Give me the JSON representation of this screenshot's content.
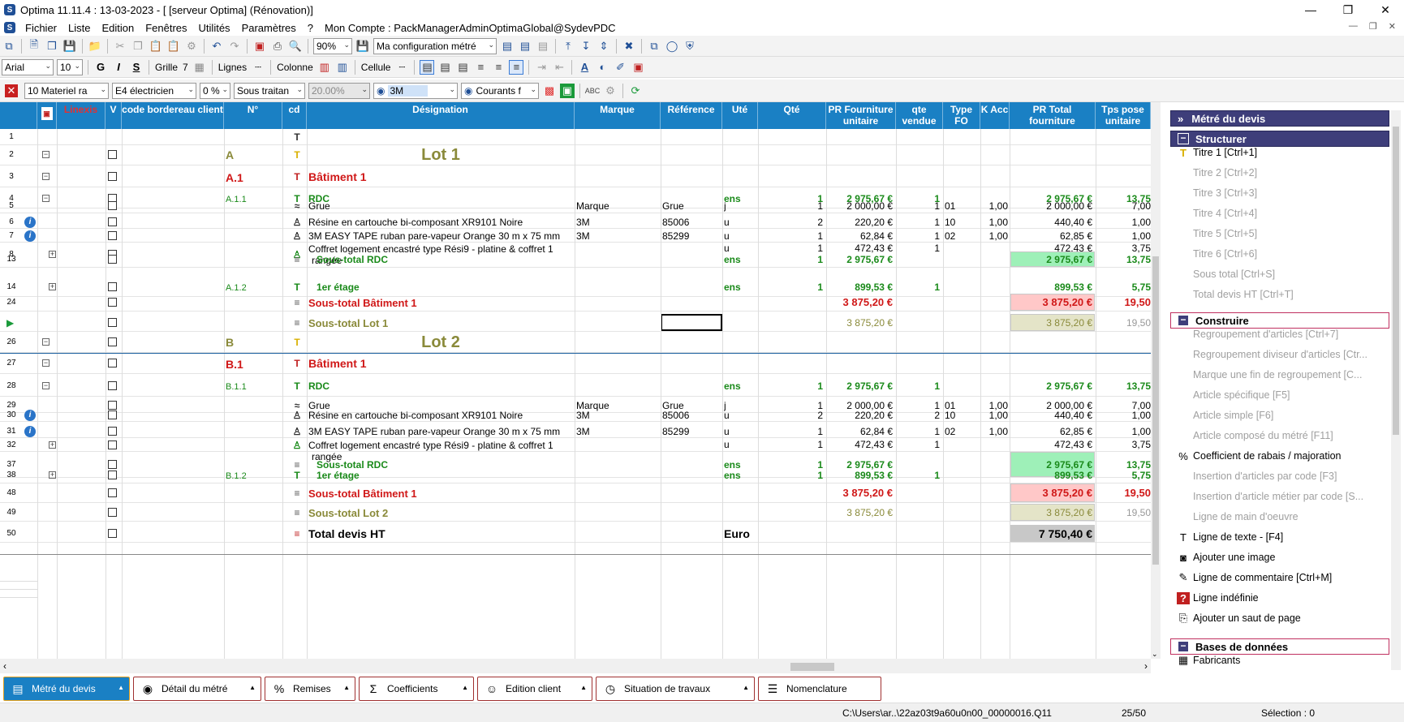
{
  "window": {
    "title": "Optima 11.11.4 : 13-03-2023 - [ [serveur Optima] (Rénovation)]",
    "app_icon": "S"
  },
  "menu": [
    "Fichier",
    "Liste",
    "Edition",
    "Fenêtres",
    "Utilités",
    "Paramètres",
    "?",
    "Mon Compte : PackManagerAdminOptimaGlobal@SydevPDC"
  ],
  "toolbar1": {
    "zoom": "90%",
    "config": "Ma configuration métré"
  },
  "toolbar2": {
    "font": "Arial",
    "size": "10",
    "bold": "G",
    "italic": "I",
    "underline": "S",
    "grille": "Grille",
    "grille_num": "7",
    "lignes": "Lignes",
    "colonne": "Colonne",
    "cellule": "Cellule"
  },
  "toolbar3": {
    "materiel": "10  Materiel ra",
    "electricien": "E4  électricien",
    "pct": "0 %",
    "sous_traitan": "Sous traitan",
    "rate": "20.00%",
    "brand": "3M",
    "courants": "Courants f"
  },
  "columns": {
    "linexis": "Linexis",
    "v": "V",
    "code": "code bordereau client",
    "n": "N°",
    "cd": "cd",
    "designation": "Désignation",
    "marque": "Marque",
    "reference": "Référence",
    "ute": "Uté",
    "qte": "Qté",
    "pr_unit": "PR Fourniture unitaire",
    "qte_vendue": "qte vendue",
    "type_fo": "Type FO",
    "k_acc": "K Acc",
    "pr_total": "PR Total fourniture",
    "tps": "Tps pose unitaire"
  },
  "rows": [
    {
      "rn": "1",
      "n": "",
      "des": "",
      "ico": "T",
      "kind": "blank"
    },
    {
      "rn": "2",
      "n": "A",
      "des": "Lot 1",
      "ico": "T1",
      "kind": "lot",
      "tog": "−"
    },
    {
      "rn": "3",
      "n": "A.1",
      "des": "Bâtiment 1",
      "ico": "T2",
      "kind": "bat",
      "tog": "−"
    },
    {
      "rn": "4",
      "n": "A.1.1",
      "des": "RDC",
      "ico": "T3",
      "kind": "rdc",
      "tog": "−",
      "ute": "ens",
      "qte": "1",
      "pru": "2 975,67 €",
      "qv": "1",
      "prt": "2 975,67 €",
      "tps": "13,75"
    },
    {
      "rn": "5",
      "n": "",
      "des": "Grue",
      "ico": "≈",
      "kind": "art",
      "marque": "Marque",
      "ref": "Grue",
      "ute": "j",
      "qte": "1",
      "pru": "2 000,00 €",
      "qv": "1",
      "fo": "01",
      "k": "1,00",
      "prt": "2 000,00 €",
      "tps": "7,00"
    },
    {
      "rn": "6",
      "n": "",
      "des": "Résine en cartouche bi-composant XR9101 Noire",
      "ico": "A",
      "kind": "art",
      "info": true,
      "marque": "3M",
      "ref": "85006",
      "ute": "u",
      "qte": "2",
      "pru": "220,20 €",
      "qv": "1",
      "fo": "10",
      "k": "1,00",
      "prt": "440,40 €",
      "tps": "1,00"
    },
    {
      "rn": "7",
      "n": "",
      "des": "3M EASY TAPE ruban pare-vapeur Orange 30 m x 75 mm",
      "ico": "A",
      "kind": "art",
      "info": true,
      "marque": "3M",
      "ref": "85299",
      "ute": "u",
      "qte": "1",
      "pru": "62,84 €",
      "qv": "1",
      "fo": "02",
      "k": "1,00",
      "prt": "62,85 €",
      "tps": "1,00"
    },
    {
      "rn": "8",
      "n": "",
      "des": "Coffret logement encastré type Rési9 - platine & coffret 1",
      "des2": "rangée",
      "ico": "A",
      "kind": "art2",
      "tog": "+",
      "ute": "u",
      "qte": "1",
      "pru": "472,43 €",
      "qv": "1",
      "prt": "472,43 €",
      "tps": "3,75"
    },
    {
      "rn": "13",
      "n": "",
      "des": "Sous-total RDC",
      "ico": "≡",
      "kind": "strdc",
      "ute": "ens",
      "qte": "1",
      "pru": "2 975,67 €",
      "prt": "2 975,67 €",
      "tps": "13,75"
    },
    {
      "rn": "14",
      "n": "A.1.2",
      "des": "1er étage",
      "ico": "T3",
      "kind": "etage",
      "tog": "+",
      "ute": "ens",
      "qte": "1",
      "pru": "899,53 €",
      "qv": "1",
      "prt": "899,53 €",
      "tps": "5,75"
    },
    {
      "rn": "24",
      "n": "",
      "des": "Sous-total Bâtiment 1",
      "ico": "≡",
      "kind": "stbat",
      "pru": "3 875,20 €",
      "prt": "3 875,20 €",
      "tps": "19,50"
    },
    {
      "rn": "",
      "n": "",
      "des": "Sous-total Lot 1",
      "ico": "≡",
      "kind": "stlot",
      "pru": "3 875,20 €",
      "prt": "3 875,20 €",
      "tps": "19,50",
      "cur": true
    },
    {
      "rn": "26",
      "n": "B",
      "des": "Lot 2",
      "ico": "T1",
      "kind": "lot",
      "tog": "−"
    },
    {
      "rn": "27",
      "n": "B.1",
      "des": "Bâtiment 1",
      "ico": "T2",
      "kind": "bat",
      "tog": "−"
    },
    {
      "rn": "28",
      "n": "B.1.1",
      "des": "RDC",
      "ico": "T3",
      "kind": "rdc",
      "tog": "−",
      "ute": "ens",
      "qte": "1",
      "pru": "2 975,67 €",
      "qv": "1",
      "prt": "2 975,67 €",
      "tps": "13,75"
    },
    {
      "rn": "29",
      "n": "",
      "des": "Grue",
      "ico": "≈",
      "kind": "art",
      "marque": "Marque",
      "ref": "Grue",
      "ute": "j",
      "qte": "1",
      "pru": "2 000,00 €",
      "qv": "1",
      "fo": "01",
      "k": "1,00",
      "prt": "2 000,00 €",
      "tps": "7,00"
    },
    {
      "rn": "30",
      "n": "",
      "des": "Résine en cartouche bi-composant XR9101 Noire",
      "ico": "A",
      "kind": "art",
      "info": true,
      "marque": "3M",
      "ref": "85006",
      "ute": "u",
      "qte": "2",
      "pru": "220,20 €",
      "qv": "2",
      "fo": "10",
      "k": "1,00",
      "prt": "440,40 €",
      "tps": "1,00"
    },
    {
      "rn": "31",
      "n": "",
      "des": "3M EASY TAPE ruban pare-vapeur Orange 30 m x 75 mm",
      "ico": "A",
      "kind": "art",
      "info": true,
      "marque": "3M",
      "ref": "85299",
      "ute": "u",
      "qte": "1",
      "pru": "62,84 €",
      "qv": "1",
      "fo": "02",
      "k": "1,00",
      "prt": "62,85 €",
      "tps": "1,00"
    },
    {
      "rn": "32",
      "n": "",
      "des": "Coffret logement encastré type Rési9 - platine & coffret 1",
      "des2": "rangée",
      "ico": "A",
      "kind": "art2",
      "tog": "+",
      "ute": "u",
      "qte": "1",
      "pru": "472,43 €",
      "qv": "1",
      "prt": "472,43 €",
      "tps": "3,75"
    },
    {
      "rn": "37",
      "n": "",
      "des": "Sous-total RDC",
      "ico": "≡",
      "kind": "strdc",
      "ute": "ens",
      "qte": "1",
      "pru": "2 975,67 €",
      "prt": "2 975,67 €",
      "tps": "13,75"
    },
    {
      "rn": "38",
      "n": "B.1.2",
      "des": "1er étage",
      "ico": "T3",
      "kind": "etage",
      "tog": "+",
      "ute": "ens",
      "qte": "1",
      "pru": "899,53 €",
      "qv": "1",
      "prt": "899,53 €",
      "tps": "5,75"
    },
    {
      "rn": "48",
      "n": "",
      "des": "Sous-total Bâtiment 1",
      "ico": "≡",
      "kind": "stbat",
      "pru": "3 875,20 €",
      "prt": "3 875,20 €",
      "tps": "19,50"
    },
    {
      "rn": "49",
      "n": "",
      "des": "Sous-total Lot 2",
      "ico": "≡",
      "kind": "stlot",
      "pru": "3 875,20 €",
      "prt": "3 875,20 €",
      "tps": "19,50"
    },
    {
      "rn": "50",
      "n": "",
      "des": "Total devis HT",
      "ico": "≡",
      "kind": "total",
      "ute": "Euro",
      "prt": "7 750,40 €"
    }
  ],
  "panel": {
    "header": "Métré du devis",
    "sections": [
      {
        "title": "Structurer",
        "items": [
          {
            "label": "Titre 1 [Ctrl+1]",
            "icon": "T",
            "enabled": true
          },
          {
            "label": "Titre 2 [Ctrl+2]",
            "enabled": false
          },
          {
            "label": "Titre 3 [Ctrl+3]",
            "enabled": false
          },
          {
            "label": "Titre 4 [Ctrl+4]",
            "enabled": false
          },
          {
            "label": "Titre 5 [Ctrl+5]",
            "enabled": false
          },
          {
            "label": "Titre 6 [Ctrl+6]",
            "enabled": false
          },
          {
            "label": "Sous total [Ctrl+S]",
            "enabled": false
          },
          {
            "label": "Total devis HT [Ctrl+T]",
            "enabled": false
          }
        ]
      },
      {
        "title": "Construire",
        "items": [
          {
            "label": "Regroupement d'articles  [Ctrl+7]",
            "enabled": false
          },
          {
            "label": "Regroupement diviseur d'articles [Ctr...",
            "enabled": false
          },
          {
            "label": "Marque une fin de regroupement   [C...",
            "enabled": false
          },
          {
            "label": "Article spécifique [F5]",
            "enabled": false
          },
          {
            "label": "Article simple [F6]",
            "enabled": false
          },
          {
            "label": "Article composé du métré [F11]",
            "enabled": false
          },
          {
            "label": "Coefficient de rabais / majoration",
            "icon": "%",
            "enabled": true
          },
          {
            "label": "Insertion d'articles par code [F3]",
            "enabled": false
          },
          {
            "label": "Insertion d'article métier par code [S...",
            "enabled": false
          },
          {
            "label": "Ligne de main d'oeuvre",
            "enabled": false
          },
          {
            "label": "Ligne de texte - [F4]",
            "icon": "T",
            "enabled": true
          },
          {
            "label": "Ajouter une image",
            "icon": "◙",
            "enabled": true
          },
          {
            "label": "Ligne de commentaire [Ctrl+M]",
            "icon": "✎",
            "enabled": true
          },
          {
            "label": "Ligne indéfinie",
            "icon": "?",
            "enabled": true
          },
          {
            "label": "Ajouter un saut de page",
            "icon": "⎘",
            "enabled": true
          }
        ]
      },
      {
        "title": "Bases de données",
        "items": [
          {
            "label": "Fabricants",
            "icon": "▦",
            "enabled": true
          }
        ]
      }
    ]
  },
  "bottom_tabs": [
    {
      "label": "Métré du devis",
      "icon": "▤",
      "active": true
    },
    {
      "label": "Détail du métré",
      "icon": "◉"
    },
    {
      "label": "Remises",
      "icon": "%"
    },
    {
      "label": "Coefficients",
      "icon": "Σ"
    },
    {
      "label": "Edition client",
      "icon": "☺"
    },
    {
      "label": "Situation de travaux",
      "icon": "◷"
    },
    {
      "label": "Nomenclature",
      "icon": "☰"
    }
  ],
  "status": {
    "path": "C:\\Users\\ar..\\22az03t9a60u0n00_00000016.Q11",
    "count": "25/50",
    "selection": "Sélection : 0"
  },
  "colors": {
    "header_blue": "#1a80c4",
    "lot": "#8a8a3a",
    "bat_red": "#d01818",
    "green": "#1a8a1a",
    "st_rdc_bg": "#9ef0b8",
    "st_bat_bg": "#ffc8c8",
    "st_lot_bg": "#e4e4c8",
    "total_bg": "#c8c8c8"
  }
}
